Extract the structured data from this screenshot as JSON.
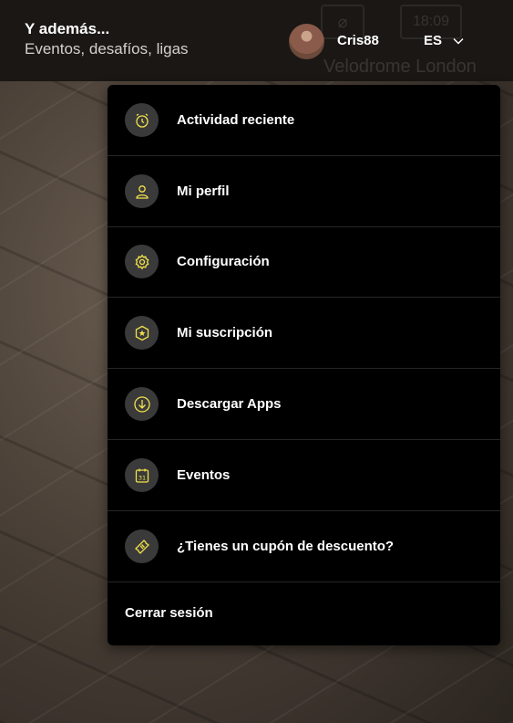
{
  "header": {
    "title": "Y además...",
    "subtitle": "Eventos, desafíos, ligas",
    "background_text": "Velodrome London",
    "background_clock": "18:09",
    "user": {
      "name": "Cris88",
      "avatar": "avatar"
    },
    "language": {
      "selected": "ES",
      "icon": "chevron-down-icon"
    }
  },
  "menu": {
    "items": [
      {
        "label": "Actividad reciente",
        "icon": "alarm-clock-icon"
      },
      {
        "label": "Mi perfil",
        "icon": "user-icon"
      },
      {
        "label": "Configuración",
        "icon": "gear-icon"
      },
      {
        "label": "Mi suscripción",
        "icon": "star-badge-icon"
      },
      {
        "label": "Descargar Apps",
        "icon": "download-icon"
      },
      {
        "label": "Eventos",
        "icon": "calendar-icon"
      },
      {
        "label": "¿Tienes un cupón de descuento?",
        "icon": "ticket-icon"
      }
    ],
    "logout_label": "Cerrar sesión"
  },
  "colors": {
    "accent": "#f2e24a",
    "menu_background": "#000000",
    "icon_background": "#3a3a3a",
    "header_background": "#1a1714"
  }
}
